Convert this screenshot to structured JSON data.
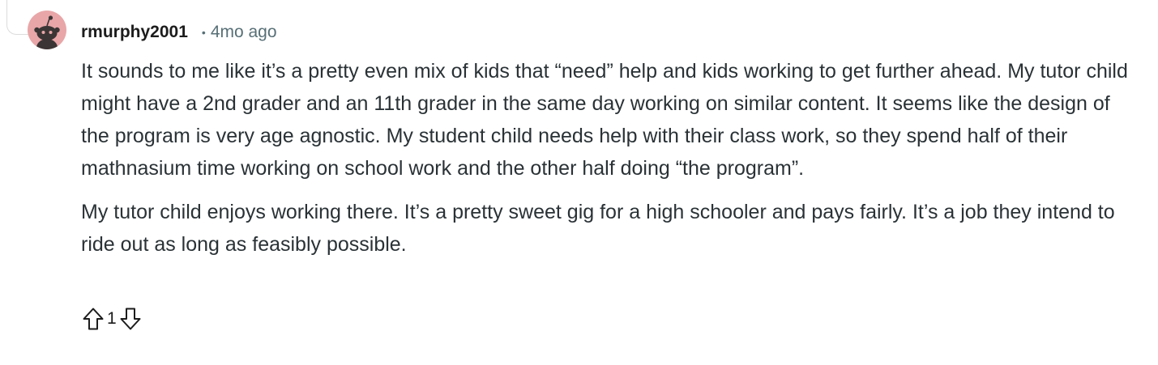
{
  "comment": {
    "author": "rmurphy2001",
    "separator": "•",
    "time": "4mo ago",
    "paragraphs": [
      "It sounds to me like it’s a pretty even mix of kids that “need” help and kids working to get further ahead. My tutor child might have a 2nd grader and an 11th grader in the same day working on similar content. It seems like the design of the program is very age agnostic. My student child needs help with their class work, so they spend half of their mathnasium time working on school work and the other half doing “the program”.",
      "My tutor child enjoys working there. It’s a pretty sweet gig for a high schooler and pays fairly. It’s a job they intend to ride out as long as feasibly possible."
    ],
    "score": "1"
  },
  "icons": {
    "avatar": "snoo-avatar-icon",
    "upvote": "upvote-arrow-icon",
    "downvote": "downvote-arrow-icon"
  },
  "colors": {
    "avatar_background": "#e8a6a8",
    "meta_text": "#576f76",
    "body_text": "#2a3236"
  }
}
